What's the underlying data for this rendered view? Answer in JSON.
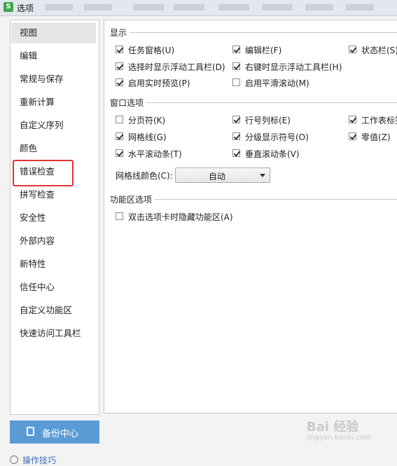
{
  "window": {
    "logo": "S",
    "title": "选项"
  },
  "sidebar": {
    "items": [
      {
        "label": "视图"
      },
      {
        "label": "编辑"
      },
      {
        "label": "常规与保存"
      },
      {
        "label": "重新计算"
      },
      {
        "label": "自定义序列"
      },
      {
        "label": "颜色"
      },
      {
        "label": "错误检查"
      },
      {
        "label": "拼写检查"
      },
      {
        "label": "安全性"
      },
      {
        "label": "外部内容"
      },
      {
        "label": "新特性"
      },
      {
        "label": "信任中心"
      },
      {
        "label": "自定义功能区"
      },
      {
        "label": "快速访问工具栏"
      }
    ],
    "active_item": "视图",
    "highlighted_item": "错误检查"
  },
  "backup": {
    "label": "备份中心"
  },
  "tips": {
    "label": "操作技巧"
  },
  "main": {
    "display": {
      "title": "显示",
      "options": [
        {
          "label": "任务窗格(U)",
          "checked": true
        },
        {
          "label": "编辑栏(F)",
          "checked": true
        },
        {
          "label": "状态栏(S)",
          "checked": true
        },
        {
          "label": "选择时显示浮动工具栏(D)",
          "checked": true
        },
        {
          "label": "右键时显示浮动工具栏(H)",
          "checked": true
        },
        {
          "label": "启用实时预览(P)",
          "checked": true
        },
        {
          "label": "启用平滑滚动(M)",
          "checked": false
        }
      ]
    },
    "window_options": {
      "title": "窗口选项",
      "options": [
        {
          "label": "分页符(K)",
          "checked": false
        },
        {
          "label": "行号列标(E)",
          "checked": true
        },
        {
          "label": "工作表标签",
          "checked": true
        },
        {
          "label": "网格线(G)",
          "checked": true
        },
        {
          "label": "分级显示符号(O)",
          "checked": true
        },
        {
          "label": "零值(Z)",
          "checked": true
        },
        {
          "label": "水平滚动条(T)",
          "checked": true
        },
        {
          "label": "垂直滚动条(V)",
          "checked": true
        }
      ],
      "gridline_color": {
        "label": "网格线颜色(C):",
        "value": "自动"
      }
    },
    "ribbon_options": {
      "title": "功能区选项",
      "options": [
        {
          "label": "双击选项卡时隐藏功能区(A)",
          "checked": false
        }
      ]
    }
  },
  "watermark": {
    "main": "Bai 经验",
    "sub": "jingyan.baidu.com"
  },
  "colors": {
    "highlight_border": "#e23434",
    "backup_button": "#5b9bd5"
  }
}
